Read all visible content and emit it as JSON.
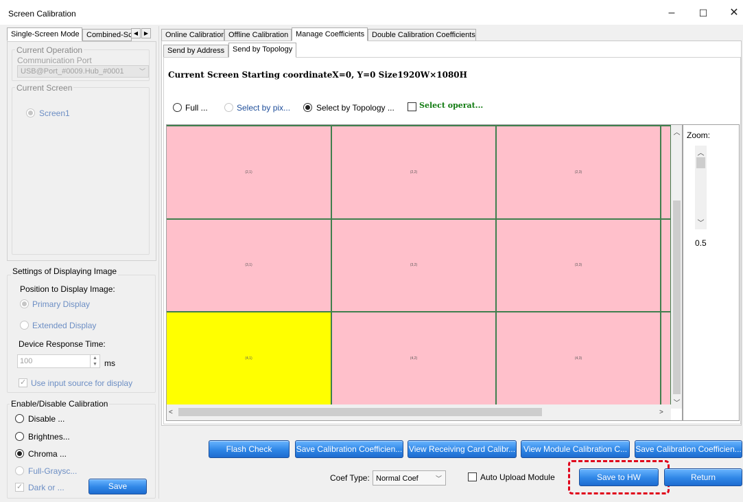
{
  "window": {
    "title": "Screen Calibration",
    "min": "–",
    "max": "☐",
    "close": "✕"
  },
  "left": {
    "tabs": [
      "Single-Screen Mode",
      "Combined-Sc"
    ],
    "current_operation": {
      "legend": "Current Operation",
      "port_label": "Communication Port",
      "port_value": "USB@Port_#0009.Hub_#0001"
    },
    "current_screen": {
      "legend": "Current Screen",
      "screens": [
        "Screen1"
      ]
    },
    "display_settings": {
      "legend": "Settings of Displaying Image",
      "position_label": "Position to Display Image:",
      "primary": "Primary Display",
      "extended": "Extended Display",
      "response_label": "Device Response Time:",
      "response_value": "100",
      "response_unit": "ms",
      "use_input": "Use input source for display"
    },
    "calibration": {
      "legend": "Enable/Disable Calibration",
      "options": [
        "Disable ...",
        "Brightnes...",
        "Chroma ...",
        "Full-Graysc...",
        "Dark or ..."
      ],
      "save": "Save"
    }
  },
  "right": {
    "tabs": [
      "Online Calibration",
      "Offline Calibration",
      "Manage Coefficients",
      "Double Calibration Coefficients"
    ],
    "subtabs": [
      "Send by Address",
      "Send by Topology"
    ],
    "screen_info": "Current Screen  Starting coordinateX=0, Y=0   Size1920W×1080H",
    "select_options": [
      "Full ...",
      "Select by pix...",
      "Select by Topology ...",
      "Select operat..."
    ],
    "grid": {
      "rows": [
        [
          "(2,1)",
          "(2,2)",
          "(2,3)"
        ],
        [
          "(3,1)",
          "(3,2)",
          "(3,3)"
        ],
        [
          "(4,1)",
          "(4,2)",
          "(4,3)"
        ]
      ],
      "selected": "(4,1)"
    },
    "zoom": {
      "label": "Zoom:",
      "value": "0.5"
    },
    "buttons": {
      "flash": "Flash Check",
      "save_coef": "Save Calibration Coefficien...",
      "view_recv": "View Receiving Card Calibr...",
      "view_module": "View Module Calibration C...",
      "save_coef2": "Save Calibration Coefficien...",
      "save_hw": "Save to HW",
      "return": "Return"
    },
    "coef_type_label": "Coef Type:",
    "coef_type_value": "Normal Coef",
    "auto_upload": "Auto Upload Module"
  },
  "colors": {
    "cell": "#ffc0cb",
    "selected_cell": "#ffff00",
    "grid_line": "#3f7f4d",
    "button_blue": "#2f86e6",
    "highlight": "#e0001a",
    "status_green": "#0f7a0f"
  }
}
